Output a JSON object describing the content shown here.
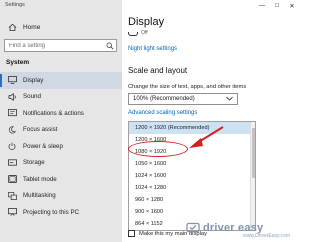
{
  "window": {
    "title": "Settings"
  },
  "sidebar": {
    "home_label": "Home",
    "search_placeholder": "Find a setting",
    "group_label": "System",
    "items": [
      {
        "label": "Display",
        "icon": "monitor-icon",
        "active": true
      },
      {
        "label": "Sound",
        "icon": "speaker-icon"
      },
      {
        "label": "Notifications & actions",
        "icon": "notification-icon"
      },
      {
        "label": "Focus assist",
        "icon": "moon-icon"
      },
      {
        "label": "Power & sleep",
        "icon": "power-icon"
      },
      {
        "label": "Storage",
        "icon": "storage-icon"
      },
      {
        "label": "Tablet mode",
        "icon": "tablet-icon"
      },
      {
        "label": "Multitasking",
        "icon": "multitask-icon"
      },
      {
        "label": "Projecting to this PC",
        "icon": "project-icon"
      }
    ]
  },
  "main": {
    "title": "Display",
    "toggle_state": "Off",
    "night_light_link": "Night light settings",
    "section_title": "Scale and layout",
    "scale_label": "Change the size of text, apps, and other items",
    "scale_value": "100% (Recommended)",
    "advanced_link": "Advanced scaling settings",
    "resolutions": [
      "1200 × 1920 (Recommended)",
      "1200 × 1600",
      "1080 × 1920",
      "1050 × 1600",
      "1024 × 1600",
      "1024 × 1280",
      "960 × 1280",
      "900 × 1600",
      "864 × 1152"
    ],
    "selected_resolution_index": 0,
    "highlighted_resolution_index": 2,
    "main_display_label": "Make this my main display"
  },
  "watermark": {
    "brand": "driver easy",
    "url": "www.DriverEasy.com"
  },
  "colors": {
    "accent": "#0067b8",
    "highlight": "#d41f1f",
    "sidebar_bg": "#e6e6e6",
    "selected_bg": "#cde1f5"
  }
}
